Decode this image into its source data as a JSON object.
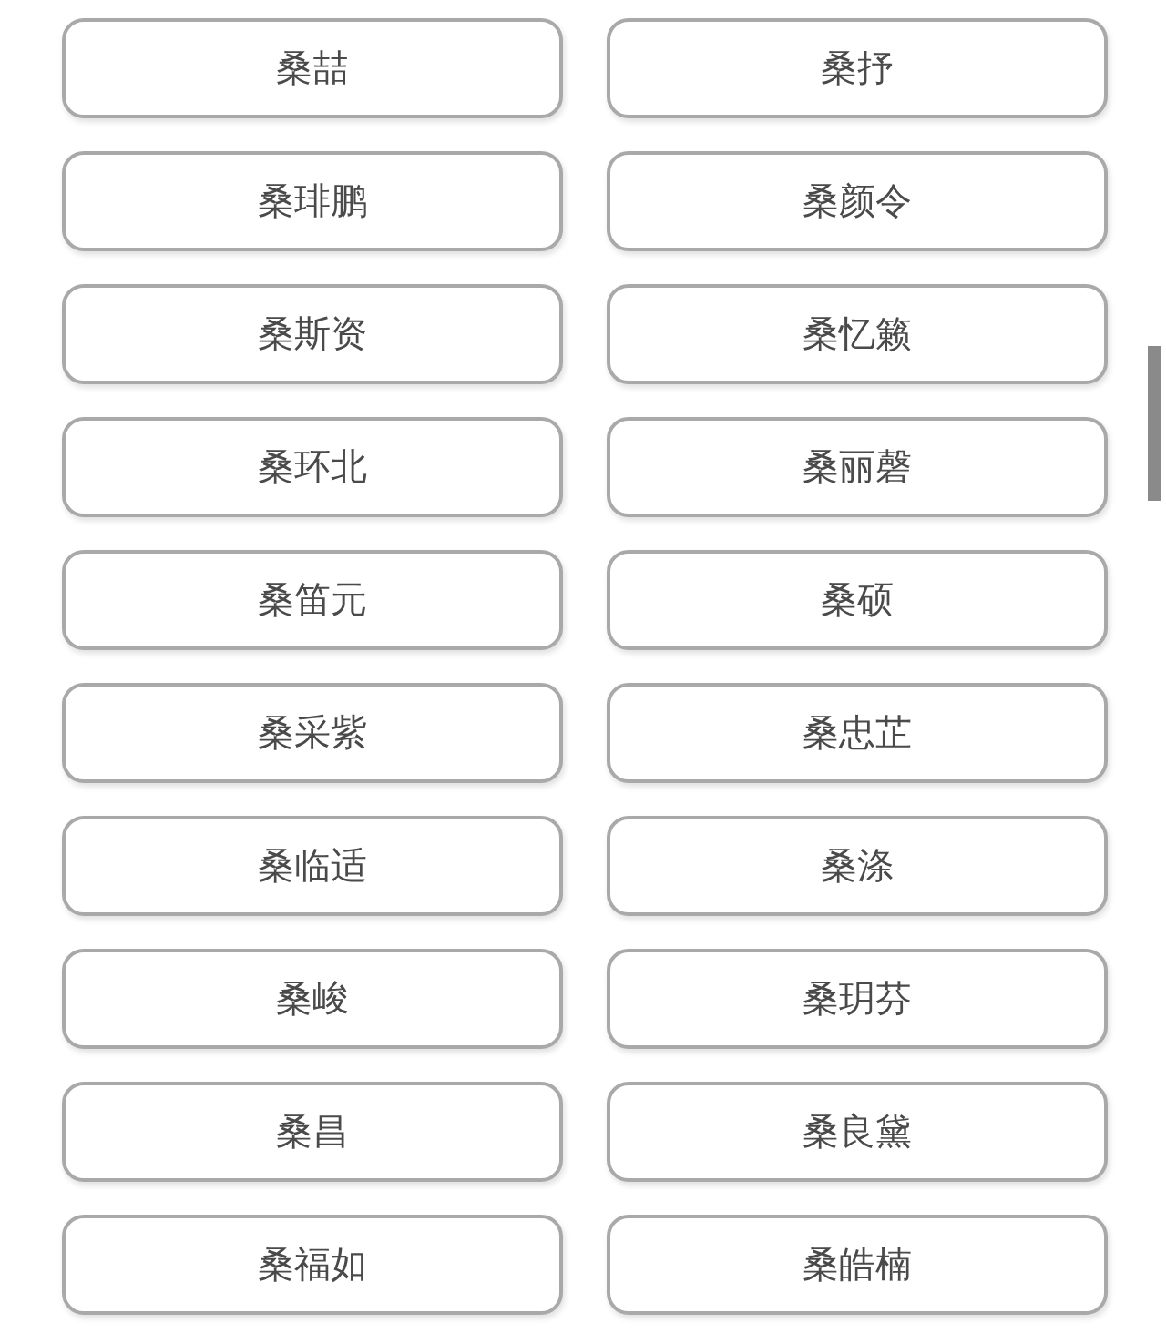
{
  "names": [
    {
      "label": "桑喆"
    },
    {
      "label": "桑抒"
    },
    {
      "label": "桑琲鹏"
    },
    {
      "label": "桑颜令"
    },
    {
      "label": "桑斯资"
    },
    {
      "label": "桑忆籁"
    },
    {
      "label": "桑环北"
    },
    {
      "label": "桑丽磬"
    },
    {
      "label": "桑笛元"
    },
    {
      "label": "桑硕"
    },
    {
      "label": "桑采紫"
    },
    {
      "label": "桑忠芷"
    },
    {
      "label": "桑临适"
    },
    {
      "label": "桑涤"
    },
    {
      "label": "桑峻"
    },
    {
      "label": "桑玥芬"
    },
    {
      "label": "桑昌"
    },
    {
      "label": "桑良黛"
    },
    {
      "label": "桑福如"
    },
    {
      "label": "桑皓楠"
    }
  ]
}
